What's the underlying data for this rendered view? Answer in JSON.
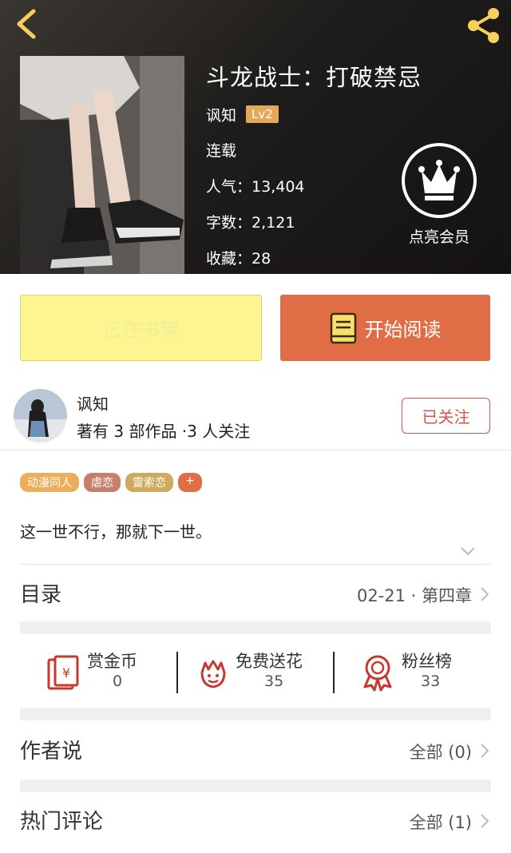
{
  "book": {
    "title": "斗龙战士：打破禁忌",
    "author": "讽知",
    "author_level": "Lv2",
    "status": "连载",
    "popularity_label": "人气：",
    "popularity": "13,404",
    "word_count_label": "字数：",
    "word_count": "2,121",
    "favorites_label": "收藏：",
    "favorites": "28",
    "summary": "这一世不行，那就下一世。"
  },
  "vip": {
    "label": "点亮会员"
  },
  "actions": {
    "shelf_label": "已在书架",
    "read_label": "开始阅读"
  },
  "author_info": {
    "name": "讽知",
    "stats": "著有 3 部作品 ·3 人关注",
    "follow_label": "已关注"
  },
  "tags": [
    {
      "label": "动漫同人",
      "color": "#ecae58"
    },
    {
      "label": "虐恋",
      "color": "#c77e6c"
    },
    {
      "label": "雷索恋",
      "color": "#cfa95e"
    },
    {
      "label": "+",
      "color": "#e06d46"
    }
  ],
  "catalog": {
    "title": "目录",
    "latest": "02-21 · 第四章"
  },
  "interactions": [
    {
      "label": "赏金币",
      "value": "0",
      "icon": "red-envelope-icon"
    },
    {
      "label": "免费送花",
      "value": "35",
      "icon": "flower-icon"
    },
    {
      "label": "粉丝榜",
      "value": "33",
      "icon": "medal-icon"
    }
  ],
  "author_notes": {
    "title": "作者说",
    "count_text": "全部 (0)"
  },
  "hot_comments": {
    "title": "热门评论",
    "count_text": "全部 (1)"
  },
  "colors": {
    "accent": "#e06d46",
    "follow": "#d9534f",
    "shelf_button": "#fdf590",
    "icon_red": "#c9382e"
  }
}
